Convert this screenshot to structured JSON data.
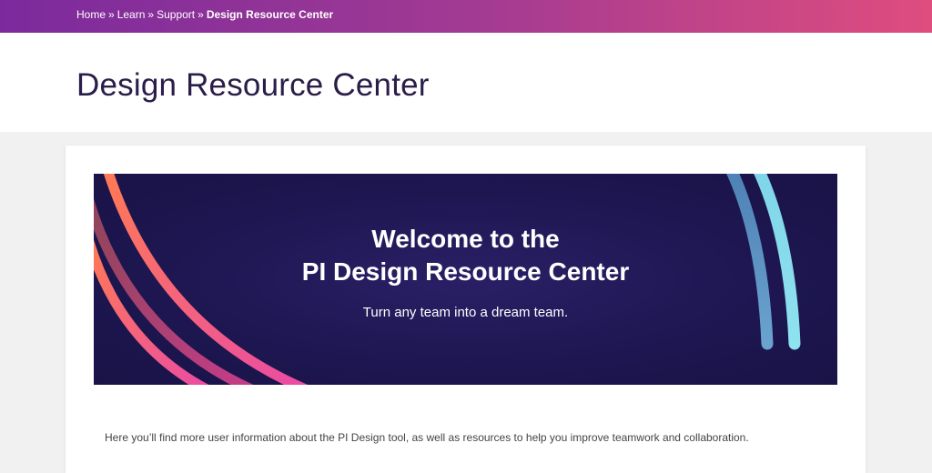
{
  "breadcrumb": {
    "items": [
      "Home",
      "Learn",
      "Support"
    ],
    "separator": "»",
    "current": "Design Resource Center"
  },
  "page": {
    "title": "Design Resource Center"
  },
  "banner": {
    "title_line1": "Welcome to the",
    "title_line2": "PI Design Resource Center",
    "subtitle": "Turn any team into a dream team."
  },
  "intro": {
    "text": "Here you’ll find more user information about the PI Design tool, as well as resources to help you improve teamwork and collaboration."
  },
  "colors": {
    "header_gradient_start": "#7b2a9d",
    "header_gradient_end": "#df4d7e",
    "title_text": "#2a1d49",
    "banner_bg": "#1d1650"
  }
}
